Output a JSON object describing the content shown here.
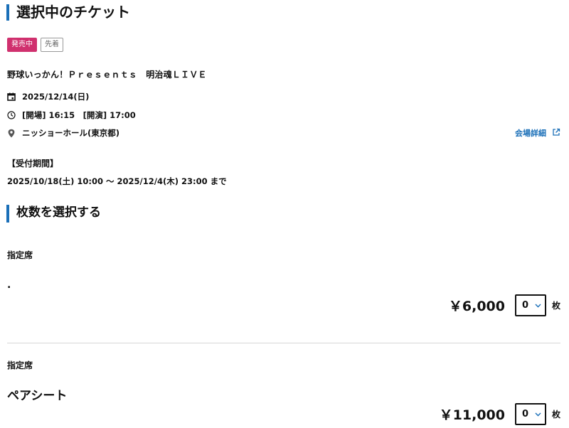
{
  "selected_ticket": {
    "heading": "選択中のチケット",
    "badges": {
      "sale": "発売中",
      "first_come": "先着"
    },
    "event_title": "野球いっかん！Ｐｒｅｓｅｎｔｓ　明治魂ＬＩＶＥ",
    "date": "2025/12/14(日)",
    "time": "[開場] 16:15　[開演] 17:00",
    "venue": "ニッショーホール(東京都)",
    "venue_link": "会場詳細",
    "period_label": "【受付期間】",
    "period_value": "2025/10/18(土) 10:00 ～ 2025/12/4(木) 23:00 まで"
  },
  "quantity": {
    "heading": "枚数を選択する",
    "seats": [
      {
        "category": "指定席",
        "name": ".",
        "price": "￥6,000",
        "qty": "0",
        "unit": "枚"
      },
      {
        "category": "指定席",
        "name": "ペアシート",
        "price": "￥11,000",
        "qty": "0",
        "unit": "枚"
      }
    ]
  },
  "colors": {
    "accent": "#1a6fb8",
    "sale_badge": "#d0306e"
  }
}
